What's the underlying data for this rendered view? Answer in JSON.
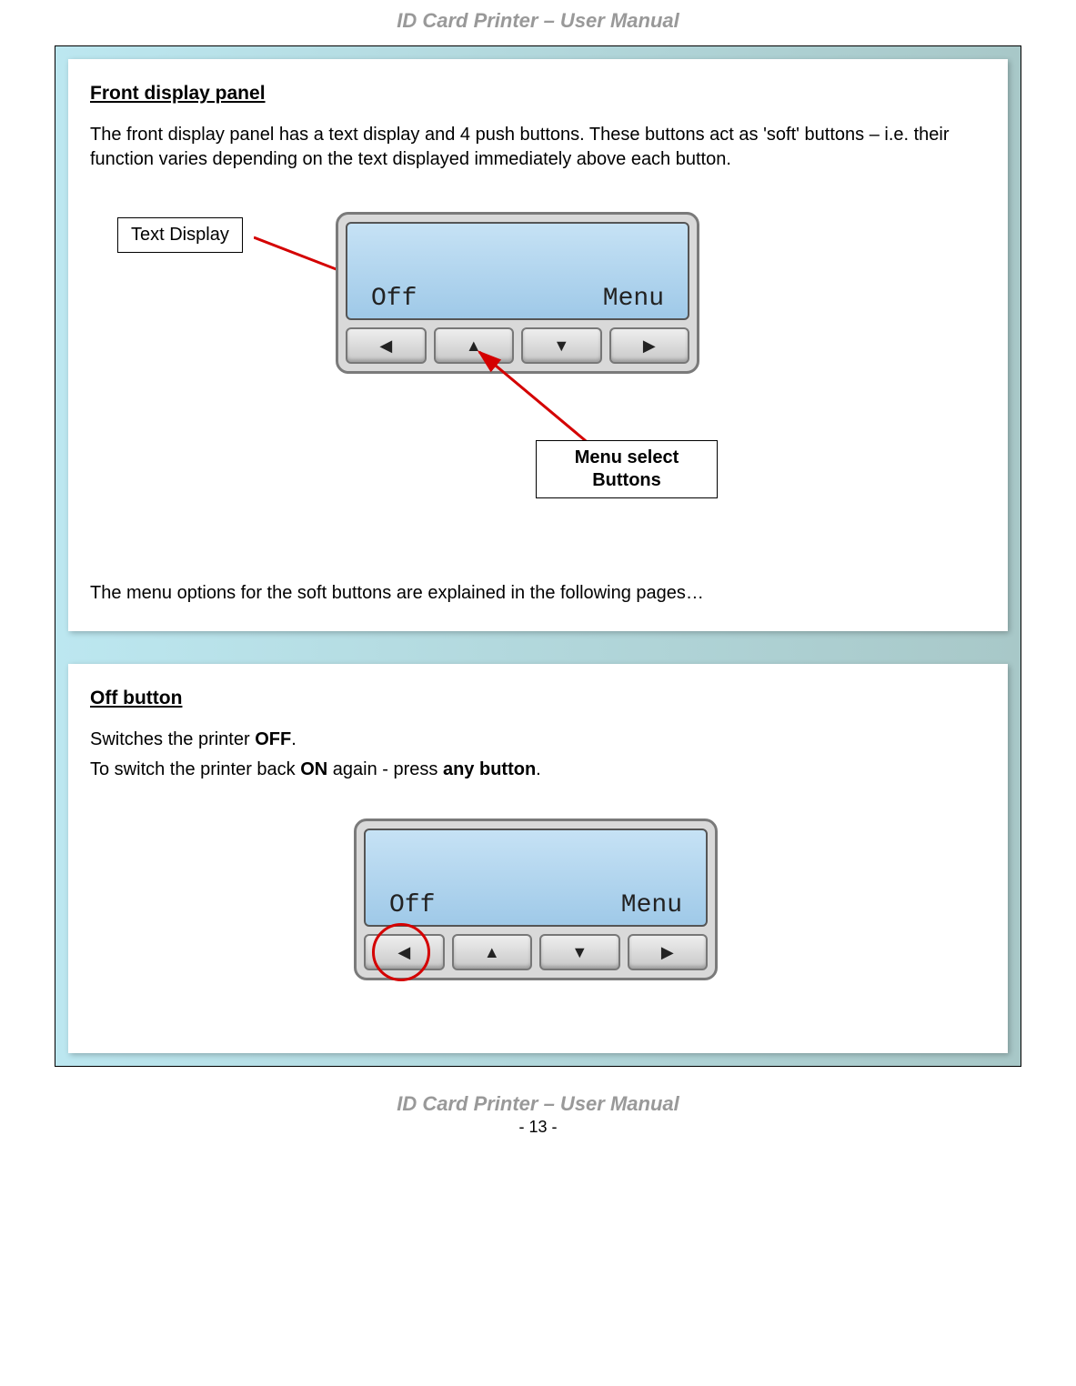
{
  "header": {
    "title": "ID Card Printer – User Manual"
  },
  "section1": {
    "title": "Front display panel",
    "para": "The front display panel has a text display and 4 push buttons. These buttons act as 'soft' buttons – i.e. their function varies depending on the text displayed immediately above each button.",
    "callout_text_display": "Text Display",
    "callout_menu_select_l1": "Menu select",
    "callout_menu_select_l2": "Buttons",
    "lcd_left": "Off",
    "lcd_right": "Menu",
    "btn_left": "◀",
    "btn_up": "▲",
    "btn_down": "▼",
    "btn_right": "▶",
    "closing": "The menu options for the soft buttons are explained in the following pages…"
  },
  "section2": {
    "title": "Off button",
    "line1_pre": "Switches the printer ",
    "line1_bold": "OFF",
    "line1_post": ".",
    "line2_pre": "To switch the printer back ",
    "line2_b1": "ON",
    "line2_mid": " again - press ",
    "line2_b2": "any button",
    "line2_post": ".",
    "lcd_left": "Off",
    "lcd_right": "Menu",
    "btn_left": "◀",
    "btn_up": "▲",
    "btn_down": "▼",
    "btn_right": "▶"
  },
  "footer": {
    "title": "ID Card Printer – User Manual",
    "page": "- 13 -"
  }
}
